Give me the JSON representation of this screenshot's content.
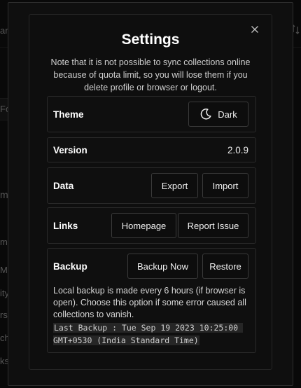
{
  "background": {
    "fragments": [
      "ar",
      "Fo",
      "m",
      "m",
      "M",
      "ity",
      "rs",
      "ch",
      "ks"
    ]
  },
  "modal": {
    "title": "Settings",
    "close_icon": "close-icon",
    "note": "Note that it is not possible to sync collections online because of quota limit, so you will lose them if you delete profile or browser or logout."
  },
  "theme": {
    "label": "Theme",
    "button_label": "Dark",
    "icon": "moon-icon"
  },
  "version": {
    "label": "Version",
    "value": "2.0.9"
  },
  "data": {
    "label": "Data",
    "export_label": "Export",
    "import_label": "Import"
  },
  "links": {
    "label": "Links",
    "homepage_label": "Homepage",
    "report_label": "Report Issue"
  },
  "backup": {
    "label": "Backup",
    "backup_now_label": "Backup Now",
    "restore_label": "Restore",
    "description": "Local backup is made every 6 hours (if browser is open). Choose this option if some error caused all collections to vanish.",
    "last_backup": "Last Backup : Tue Sep 19 2023 10:25:00 GMT+0530 (India Standard Time)"
  },
  "colors": {
    "background": "#0e0e0e",
    "border": "#2a2a2a",
    "text": "#ffffff"
  }
}
